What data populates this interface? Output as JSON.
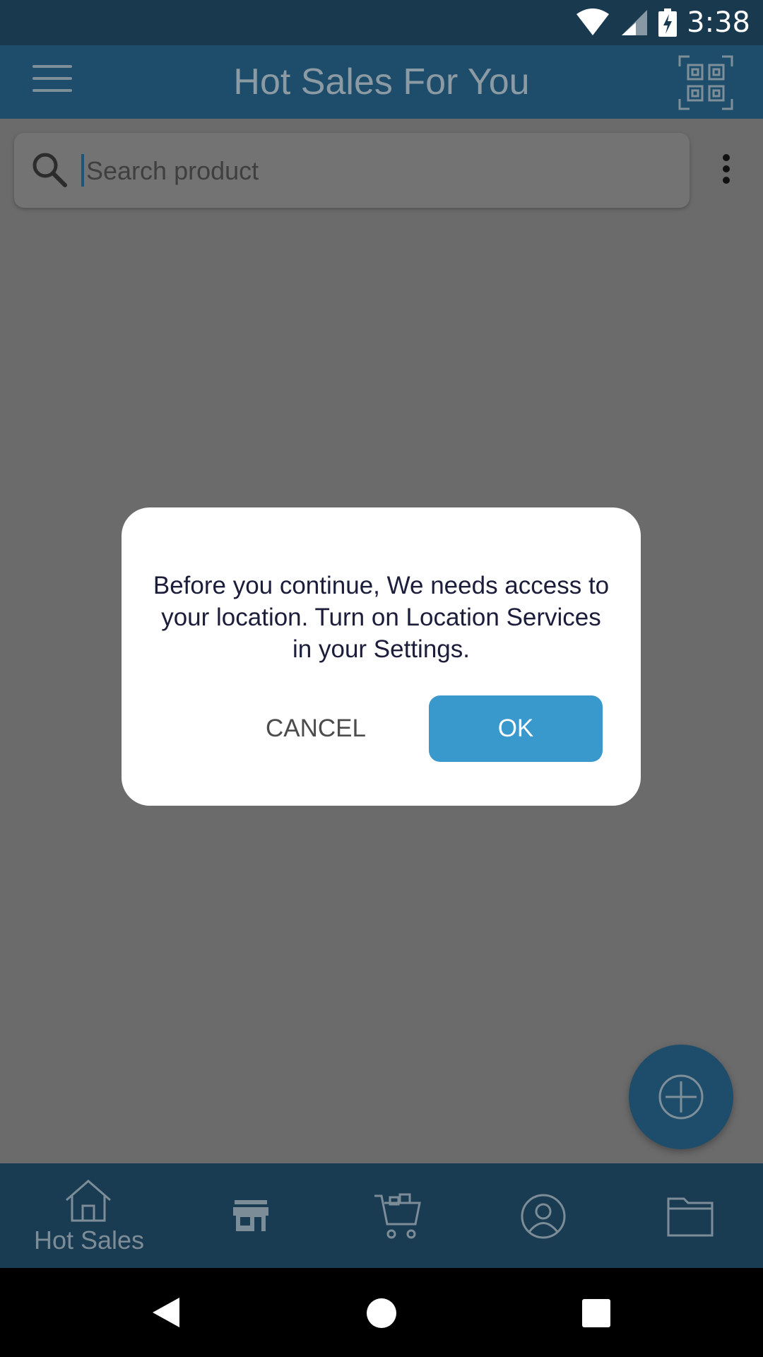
{
  "status_bar": {
    "time": "3:38",
    "icons": [
      "wifi-icon",
      "cell-signal-icon",
      "battery-charging-icon"
    ]
  },
  "app_bar": {
    "title": "Hot Sales For You",
    "left_icon": "hamburger-menu-icon",
    "right_icon": "qr-code-icon"
  },
  "search": {
    "placeholder": "Search product",
    "icon": "search-icon"
  },
  "dialog": {
    "message": "Before you continue, We needs access to your location. Turn on Location Services in your Settings.",
    "cancel_label": "CANCEL",
    "ok_label": "OK"
  },
  "bottom_nav": {
    "items": [
      {
        "label": "Hot Sales",
        "icon": "home-icon"
      },
      {
        "label": "",
        "icon": "store-icon"
      },
      {
        "label": "",
        "icon": "cart-icon"
      },
      {
        "label": "",
        "icon": "user-icon"
      },
      {
        "label": "",
        "icon": "folder-icon"
      }
    ]
  },
  "colors": {
    "app_bar": "#1e4d6b",
    "status_bar": "#19394f",
    "ok_button": "#3998cc",
    "overlay": "#6b6b6b"
  }
}
